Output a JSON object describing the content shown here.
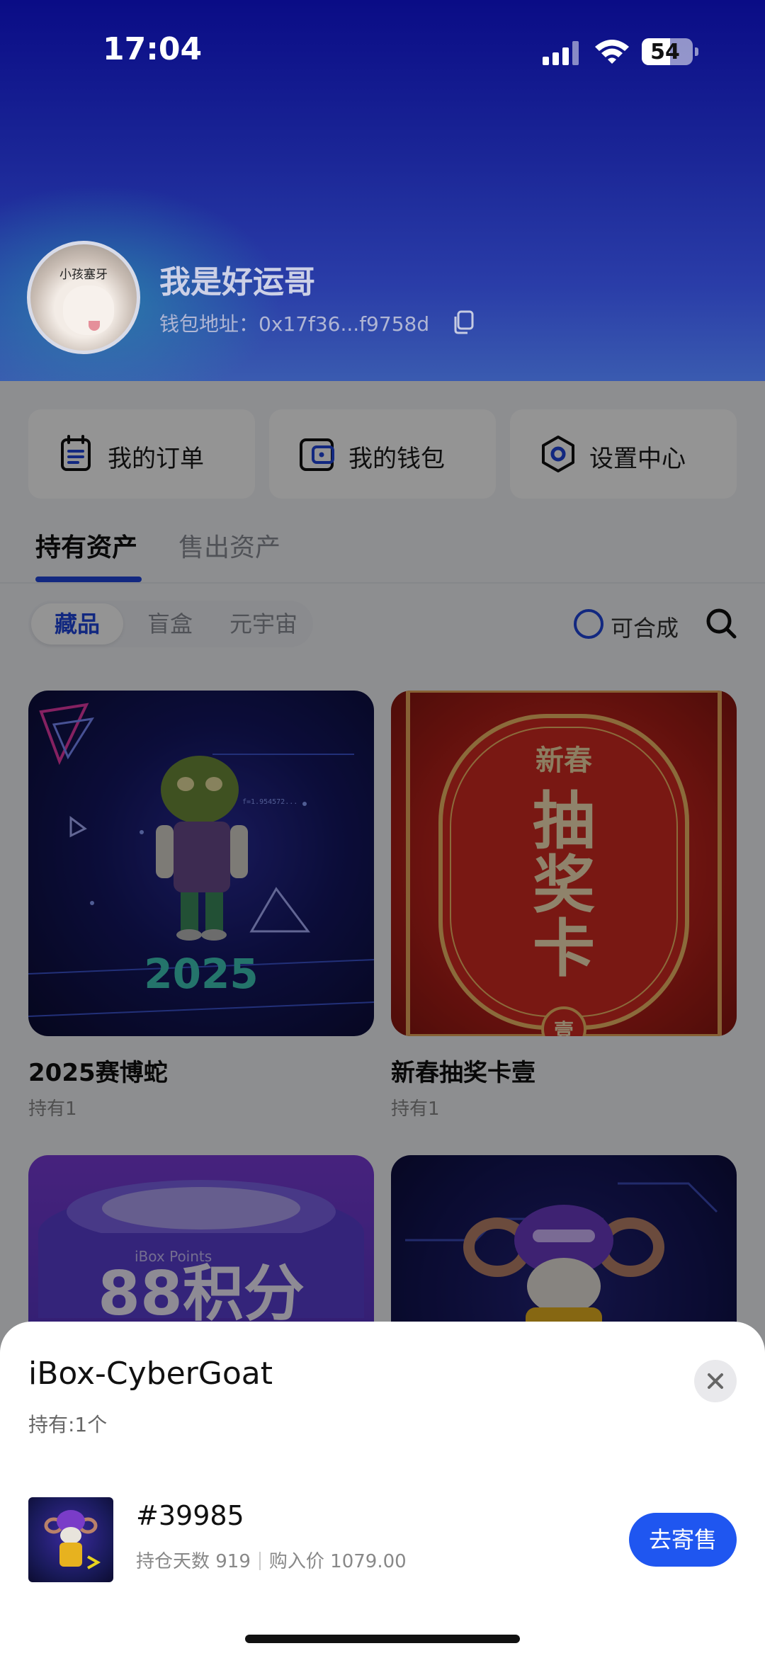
{
  "status_bar": {
    "time": "17:04",
    "battery": "54"
  },
  "profile": {
    "avatar_caption": "小孩塞牙",
    "username": "我是好运哥",
    "wallet_label": "钱包地址：0x17f36...f9758d"
  },
  "quick_actions": [
    {
      "label": "我的订单",
      "icon": "order-icon"
    },
    {
      "label": "我的钱包",
      "icon": "wallet-icon"
    },
    {
      "label": "设置中心",
      "icon": "settings-icon"
    }
  ],
  "tabs": [
    {
      "label": "持有资产",
      "active": true
    },
    {
      "label": "售出资产",
      "active": false
    }
  ],
  "filters": {
    "segments": [
      "藏品",
      "盲盒",
      "元宇宙"
    ],
    "selected": "藏品",
    "compose_label": "可合成"
  },
  "cards": [
    {
      "name": "2025赛博蛇",
      "hold": "持有1",
      "art_text": "2025",
      "small_text": "f=1.954572..."
    },
    {
      "name": "新春抽奖卡壹",
      "hold": "持有1",
      "art_text_top": "新春",
      "art_text_main": [
        "抽",
        "奖",
        "卡"
      ],
      "art_bottom": "壹"
    },
    {
      "name": "",
      "hold": "",
      "art_text": "88积分",
      "small_text": "iBox Points"
    },
    {
      "name": "",
      "hold": ""
    }
  ],
  "sheet": {
    "title": "iBox-CyberGoat",
    "holding": "持有:1个",
    "token_id": "#39985",
    "days_label": "持仓天数 919",
    "price_label": "购入价 1079.00",
    "action_label": "去寄售"
  },
  "colors": {
    "accent": "#1f45dd",
    "button": "#1f56f0",
    "header_top": "#0a0c86"
  }
}
